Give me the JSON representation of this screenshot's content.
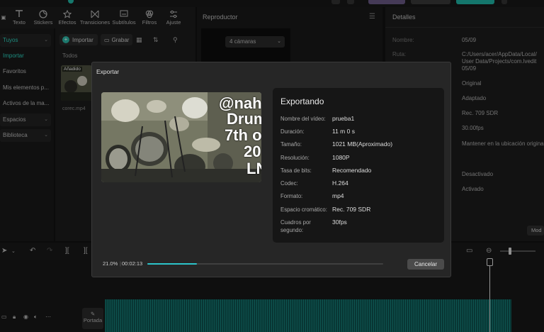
{
  "toolbar": {
    "tools": [
      {
        "label": "Texto",
        "icon": "text-icon"
      },
      {
        "label": "Stickers",
        "icon": "sticker-icon"
      },
      {
        "label": "Efectos",
        "icon": "effects-icon"
      },
      {
        "label": "Transiciones",
        "icon": "transitions-icon"
      },
      {
        "label": "Subtítulos",
        "icon": "subtitles-icon"
      },
      {
        "label": "Filtros",
        "icon": "filters-icon"
      },
      {
        "label": "Ajuste",
        "icon": "adjust-icon"
      }
    ]
  },
  "sidebar": {
    "items": [
      {
        "label": "Tuyos",
        "selected": true
      },
      {
        "label": "Importar",
        "selected": true
      },
      {
        "label": "Favoritos"
      },
      {
        "label": "Mis elementos p..."
      },
      {
        "label": "Activos de la ma..."
      },
      {
        "label": "Espacios"
      },
      {
        "label": "Biblioteca"
      }
    ]
  },
  "media": {
    "import_label": "Importar",
    "record_label": "Grabar",
    "filter_all": "Todos",
    "thumb_tag": "Añadido",
    "thumb_name": "corec.mp4"
  },
  "player": {
    "title": "Reproductor",
    "camera_select": "4 cámaras"
  },
  "details": {
    "title": "Detalles",
    "rows": [
      {
        "label": "Nombre:",
        "value": "05/09"
      },
      {
        "label": "Ruta:",
        "value": "C:/Users/acer/AppData/Local/"
      },
      {
        "label": "",
        "value": "User Data/Projects/com.lvedit"
      },
      {
        "label": "",
        "value": "05/09"
      },
      {
        "label": "",
        "value": "Original"
      },
      {
        "label": "",
        "value": "Adaptado"
      },
      {
        "label": "",
        "value": "Rec. 709 SDR"
      },
      {
        "label": "",
        "value": "30.00fps"
      },
      {
        "label": "",
        "value": "Mantener en la ubicación original"
      },
      {
        "label": "",
        "value": "Desactivado"
      },
      {
        "label": "",
        "value": "Activado"
      }
    ],
    "modify_label": "Mod"
  },
  "timeline": {
    "cover_label": "Portada"
  },
  "export_dialog": {
    "title": "Exportar",
    "heading": "Exportando",
    "preview_overlay": [
      "@nah",
      "Drum",
      "7th o",
      "20",
      "LN"
    ],
    "fields": [
      {
        "label": "Nombre del vídeo:",
        "value": "prueba1"
      },
      {
        "label": "Duración:",
        "value": "11 m 0 s"
      },
      {
        "label": "Tamaño:",
        "value": "1021 MB(Aproximado)"
      },
      {
        "label": "Resolución:",
        "value": "1080P"
      },
      {
        "label": "Tasa de bits:",
        "value": "Recomendado"
      },
      {
        "label": "Codec:",
        "value": "H.264"
      },
      {
        "label": "Formato:",
        "value": "mp4"
      },
      {
        "label": "Espacio cromático:",
        "value": "Rec. 709 SDR"
      },
      {
        "label": "Cuadros por segundo:",
        "value": "30fps"
      }
    ],
    "progress_percent_text": "21.0%",
    "progress_fraction": 0.21,
    "elapsed": "00:02:13",
    "cancel_label": "Cancelar"
  },
  "colors": {
    "accent": "#2bd4c0",
    "progress": "#2cc4c9",
    "dialog_bg": "#262626",
    "panel_bg": "#161616"
  }
}
